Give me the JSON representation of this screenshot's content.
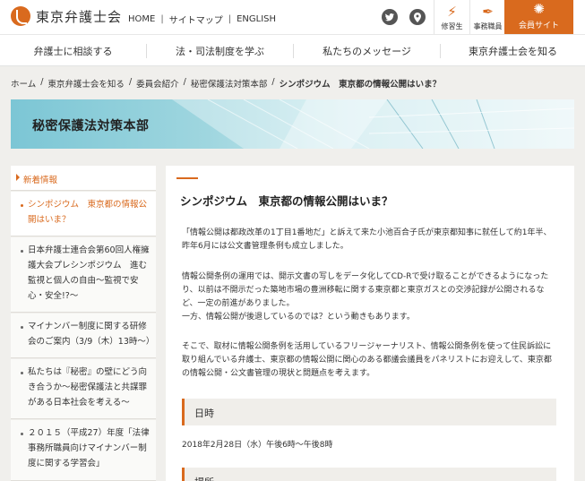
{
  "header": {
    "logo_text": "東京弁護士会",
    "links": [
      "HOME",
      "サイトマップ",
      "ENGLISH"
    ],
    "separator": "|",
    "twitter_icon": "twitter-icon",
    "map_icon": "map-pin-icon",
    "buttons": [
      {
        "label": "修習生",
        "icon": "lightning-icon"
      },
      {
        "label": "事務職員",
        "icon": "pen-icon"
      }
    ],
    "member_site": {
      "label": "会員サイト",
      "icon": "sun-emblem-icon"
    },
    "accent_color": "#d96a1e"
  },
  "nav": {
    "items": [
      "弁護士に相談する",
      "法・司法制度を学ぶ",
      "私たちのメッセージ",
      "東京弁護士会を知る"
    ]
  },
  "breadcrumb": {
    "items": [
      "ホーム",
      "東京弁護士会を知る",
      "委員会紹介",
      "秘密保護法対策本部"
    ],
    "current": "シンポジウム　東京都の情報公開はいま？",
    "separator": "/"
  },
  "banner": {
    "title": "秘密保護法対策本部"
  },
  "sidebar": {
    "heading": "新着情報",
    "items": [
      "シンポジウム　東京都の情報公開はいま？",
      "日本弁護士連合会第60回人権擁護大会プレシンポジウム　進む監視と個人の自由〜監視で安心・安全!?〜",
      "マイナンバー制度に関する研修会のご案内（3/9（木）13時〜）",
      "私たちは『秘密』の壁にどう向き合うか〜秘密保護法と共謀罪がある日本社会を考える〜",
      "２０１５（平成27）年度「法律事務所職員向けマイナンバー制度に関する学習会」"
    ]
  },
  "article": {
    "title": "シンポジウム　東京都の情報公開はいま？",
    "paragraphs": [
      "「情報公開は都政改革の1丁目1番地だ」と訴えて来た小池百合子氏が東京都知事に就任して約1年半、昨年6月には公文書管理条例も成立しました。",
      "情報公開条例の運用では、開示文書の写しをデータ化してCD-Rで受け取ることができるようになったり、以前は不開示だった築地市場の豊洲移転に関する東京都と東京ガスとの交渉記録が公開されるなど、一定の前進がありました。",
      "一方、情報公開が後退しているのでは？という動きもあります。",
      "そこで、取材に情報公開条例を活用しているフリージャーナリスト、情報公開条例を使って住民訴訟に取り組んでいる弁護士、東京都の情報公開に関心のある都議会議員をパネリストにお迎えして、東京都の情報公開・公文書管理の現状と問題点を考えます。"
    ],
    "sections": [
      {
        "heading": "日時",
        "value": "2018年2月28日（水）午後6時〜午後8時"
      },
      {
        "heading": "場所",
        "value": ""
      }
    ]
  }
}
